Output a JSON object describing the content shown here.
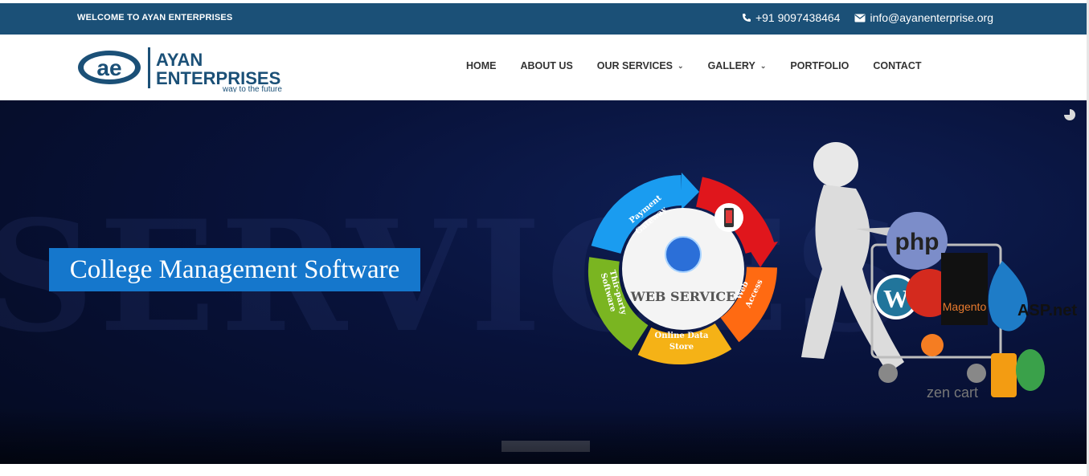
{
  "topbar": {
    "welcome": "WELCOME TO AYAN ENTERPRISES",
    "phone": "+91 9097438464",
    "email": "info@ayanenterprise.org"
  },
  "logo": {
    "line1": "AYAN",
    "line2": "ENTERPRISES",
    "tagline": "way to the future"
  },
  "nav": {
    "home": "HOME",
    "about": "ABOUT US",
    "services": "OUR SERVICES",
    "gallery": "GALLERY",
    "portfolio": "PORTFOLIO",
    "contact": "CONTACT"
  },
  "hero": {
    "title": "College Management Software",
    "cycle": {
      "center": "WEB SERVICE",
      "payment1": "Payment",
      "payment2": "Gateway",
      "web1": "Web",
      "web2": "Access",
      "store1": "Online Data",
      "store2": "Store",
      "third1": "Thir-party",
      "third2": "Software"
    },
    "tech": {
      "php": "php",
      "asp": "ASP.net",
      "magento": "Magento",
      "zencart": "zen cart"
    }
  },
  "colors": {
    "topbar": "#1b5077",
    "accent": "#1577cc",
    "logo": "#1b5077"
  },
  "icons": {
    "phone": "phone-icon",
    "email": "envelope-icon"
  }
}
